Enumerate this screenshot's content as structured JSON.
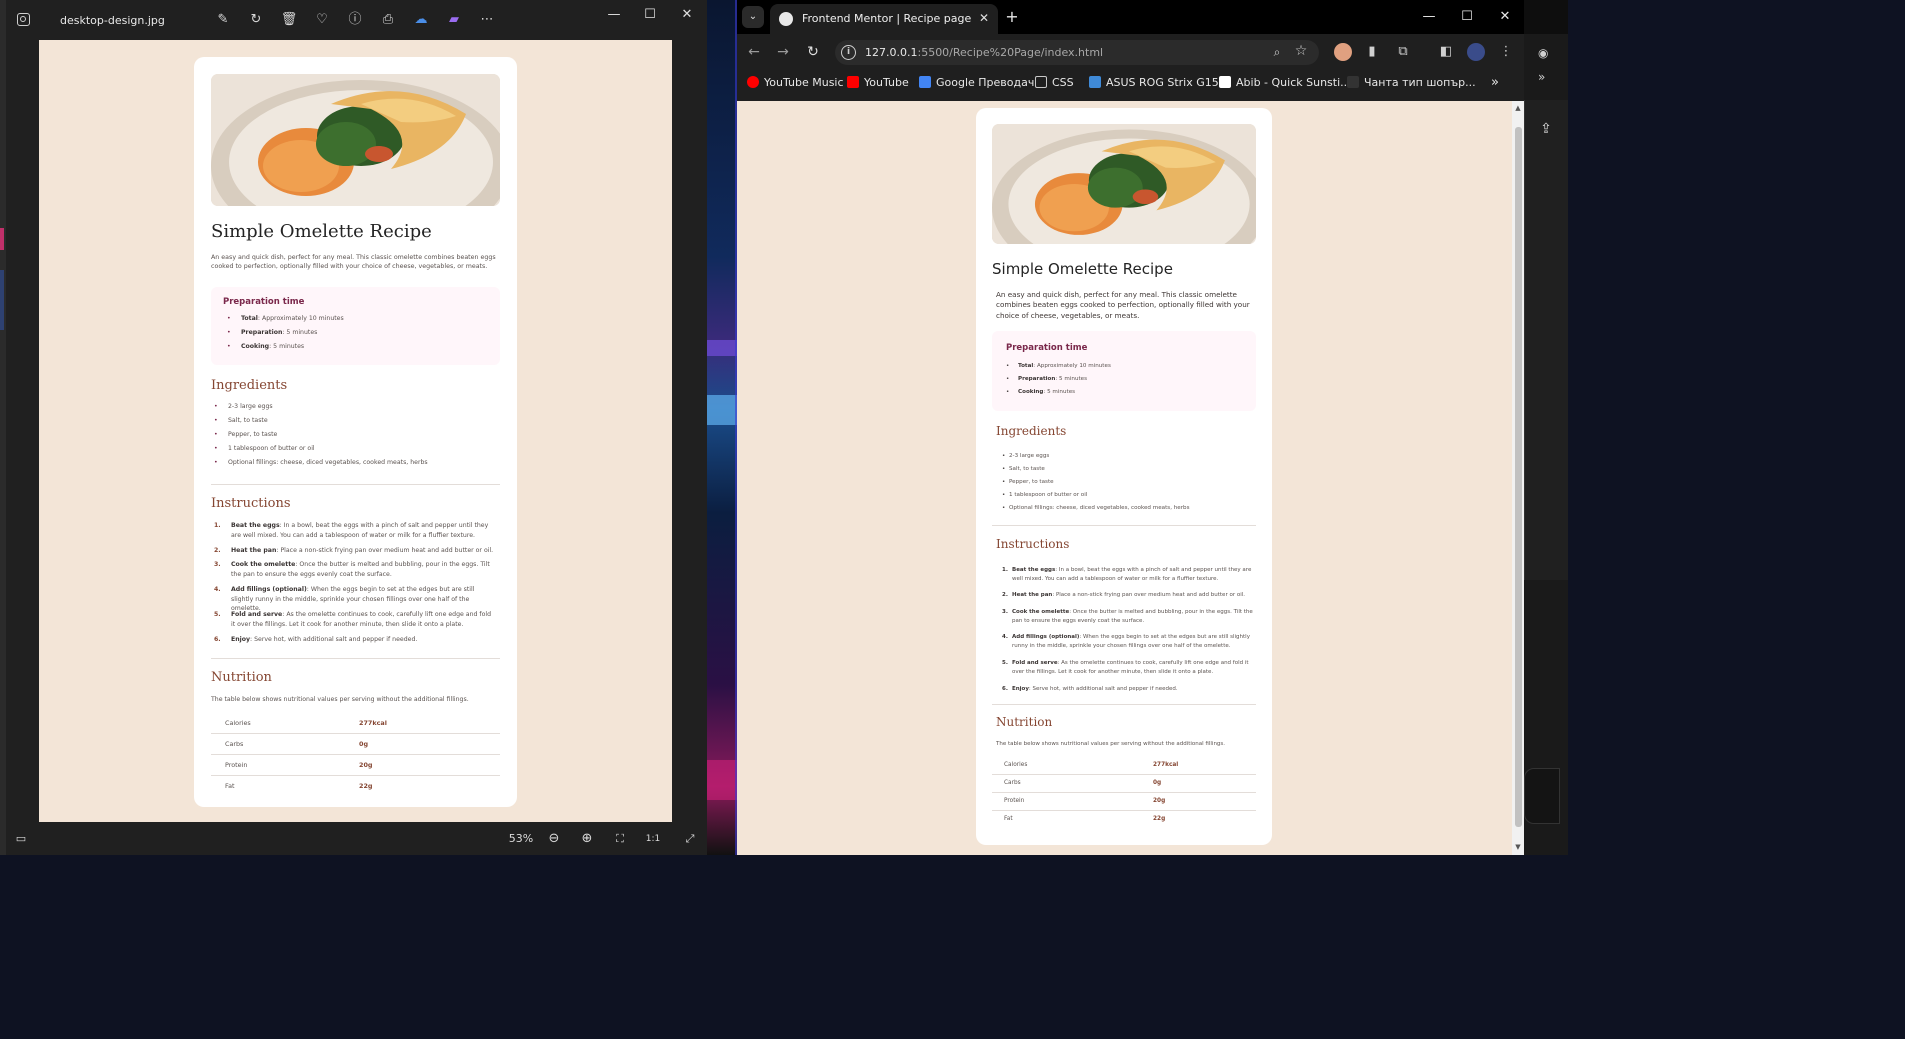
{
  "photos": {
    "filename": "desktop-design.jpg",
    "zoom": "53%"
  },
  "browser": {
    "tab_title": "Frontend Mentor | Recipe page",
    "url_host": "127.0.0.1",
    "url_rest": ":5500/Recipe%20Page/index.html",
    "bookmarks": [
      {
        "label": "YouTube Music",
        "color": "#ff0000"
      },
      {
        "label": "YouTube",
        "color": "#ff0000"
      },
      {
        "label": "Google Преводач",
        "color": "#4285f4"
      },
      {
        "label": "CSS",
        "color": "#9aa0a6"
      },
      {
        "label": "ASUS ROG Strix G15...",
        "color": "#3f8ad8"
      },
      {
        "label": "Abib - Quick Sunsti...",
        "color": "#ffffff"
      },
      {
        "label": "Чанта тип шопър...",
        "color": "#333333"
      }
    ]
  },
  "recipe": {
    "title": "Simple Omelette Recipe",
    "intro": "An easy and quick dish, perfect for any meal. This classic omelette combines beaten eggs cooked to perfection, optionally filled with your choice of cheese, vegetables, or meats.",
    "prep_title": "Preparation time",
    "prep": [
      {
        "label": "Total",
        "text": ": Approximately 10 minutes"
      },
      {
        "label": "Preparation",
        "text": ": 5 minutes"
      },
      {
        "label": "Cooking",
        "text": ": 5 minutes"
      }
    ],
    "ingredients_title": "Ingredients",
    "ingredients": [
      "2-3 large eggs",
      "Salt, to taste",
      "Pepper, to taste",
      "1 tablespoon of butter or oil",
      "Optional fillings: cheese, diced vegetables, cooked meats, herbs"
    ],
    "instructions_title": "Instructions",
    "instructions": [
      {
        "num": "1.",
        "label": "Beat the eggs",
        "text": ": In a bowl, beat the eggs with a pinch of salt and pepper until they are well mixed. You can add a tablespoon of water or milk for a fluffier texture."
      },
      {
        "num": "2.",
        "label": "Heat the pan",
        "text": ": Place a non-stick frying pan over medium heat and add butter or oil."
      },
      {
        "num": "3.",
        "label": "Cook the omelette",
        "text": ": Once the butter is melted and bubbling, pour in the eggs. Tilt the pan to ensure the eggs evenly coat the surface."
      },
      {
        "num": "4.",
        "label": "Add fillings (optional)",
        "text": ": When the eggs begin to set at the edges but are still slightly runny in the middle, sprinkle your chosen fillings over one half of the omelette."
      },
      {
        "num": "5.",
        "label": "Fold and serve",
        "text": ": As the omelette continues to cook, carefully lift one edge and fold it over the fillings. Let it cook for another minute, then slide it onto a plate."
      },
      {
        "num": "6.",
        "label": "Enjoy",
        "text": ": Serve hot, with additional salt and pepper if needed."
      }
    ],
    "nutrition_title": "Nutrition",
    "nutrition_intro": "The table below shows nutritional values per serving without the additional fillings.",
    "nutrition": [
      {
        "label": "Calories",
        "value": "277kcal"
      },
      {
        "label": "Carbs",
        "value": "0g"
      },
      {
        "label": "Protein",
        "value": "20g"
      },
      {
        "label": "Fat",
        "value": "22g"
      }
    ]
  },
  "colors": {
    "page_bg": "#f3e5d7",
    "heading_brown": "#854632",
    "prep_rose": "#7a284b",
    "prep_bg": "#fff6fa"
  }
}
